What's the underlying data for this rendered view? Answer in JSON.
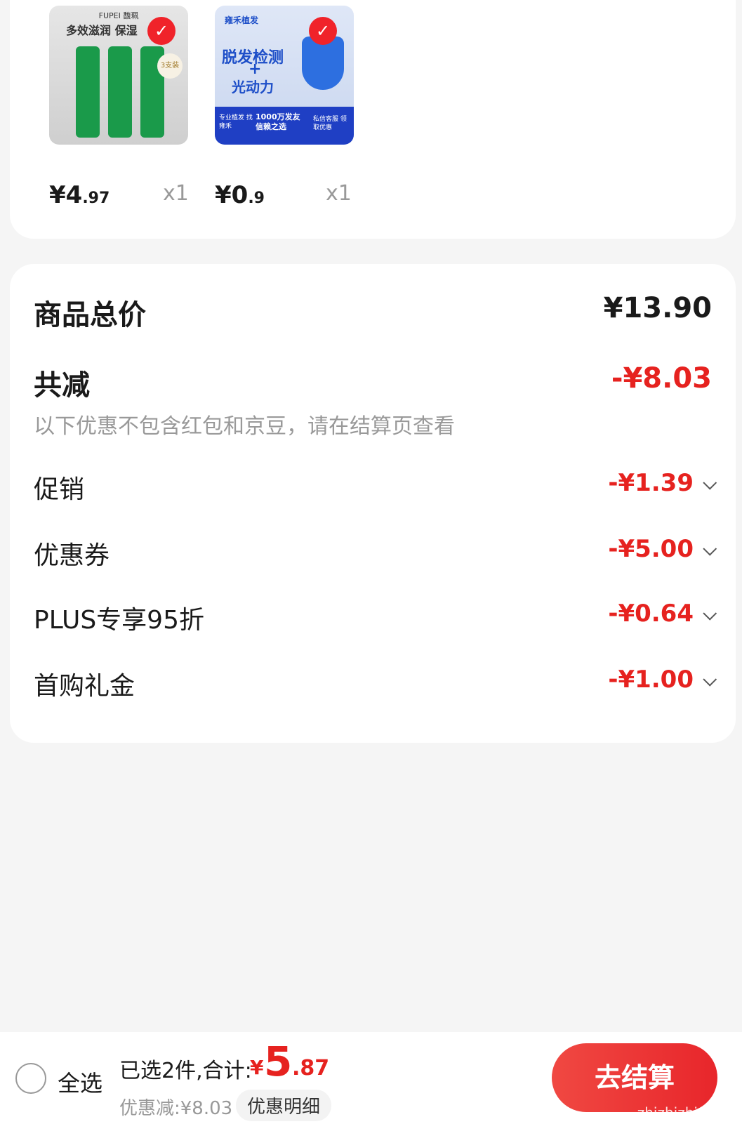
{
  "products": [
    {
      "brand_top": "FUPEI 馥珮",
      "banner": "多效滋润 保湿",
      "badge": "3支装",
      "price_int": "¥4",
      "price_dec": ".97",
      "qty": "x1"
    },
    {
      "brand_top": "雍禾植发",
      "banner_line1": "脱发检测",
      "banner_plus": "+",
      "banner_line2": "光动力",
      "footer_1": "专业植发 找雍禾",
      "footer_2": "1000万发友 信赖之选",
      "footer_3": "私信客服 领取优惠",
      "price_int": "¥0",
      "price_dec": ".9",
      "qty": "x1"
    }
  ],
  "summary": {
    "total_label": "商品总价",
    "total_value": "¥13.90",
    "discount_label": "共减",
    "discount_value": "-¥8.03",
    "note": "以下优惠不包含红包和京豆，请在结算页查看",
    "items": [
      {
        "label": "促销",
        "value": "-¥1.39"
      },
      {
        "label": "优惠券",
        "value": "-¥5.00"
      },
      {
        "label": "PLUS专享95折",
        "value": "-¥0.64"
      },
      {
        "label": "首购礼金",
        "value": "-¥1.00"
      }
    ]
  },
  "bottom": {
    "select_all": "全选",
    "selected_text": "已选2件,合计:",
    "total_symbol": "¥",
    "total_int": "5",
    "total_dec": ".87",
    "saved_text": "优惠减:¥8.03",
    "detail_button": "优惠明细",
    "checkout_button": "去结算",
    "watermark": "zhizhizhi.com"
  },
  "colors": {
    "accent": "#e6221f",
    "bg": "#f5f5f5"
  }
}
